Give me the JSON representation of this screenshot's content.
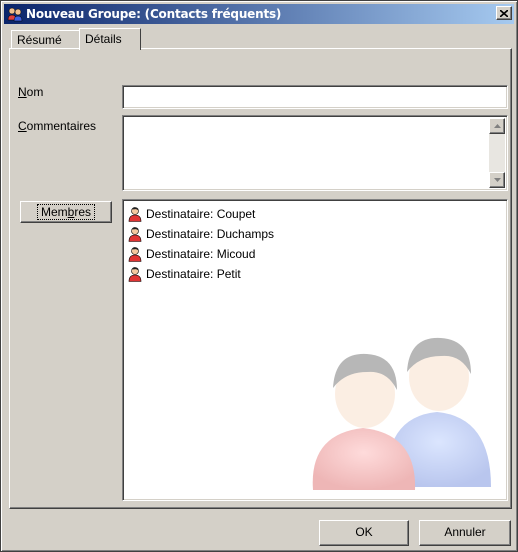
{
  "window": {
    "title": "Nouveau Groupe: (Contacts fréquents)",
    "close_glyph": "×"
  },
  "tabs": [
    {
      "label": "Résumé",
      "active": false
    },
    {
      "label": "Détails",
      "active": true
    }
  ],
  "form": {
    "nom_label_u": "N",
    "nom_label_rest": "om",
    "nom_value": "",
    "commentaires_label_u": "C",
    "commentaires_label_rest": "ommentaires",
    "commentaires_value": "",
    "membres_button_pre": "Mem",
    "membres_button_u": "b",
    "membres_button_post": "res"
  },
  "members": [
    {
      "label": "Destinataire: Coupet"
    },
    {
      "label": "Destinataire: Duchamps"
    },
    {
      "label": "Destinataire: Micoud"
    },
    {
      "label": "Destinataire: Petit"
    }
  ],
  "footer": {
    "ok_label": "OK",
    "cancel_label": "Annuler"
  },
  "colors": {
    "title_gradient_start": "#0a246a",
    "title_gradient_end": "#a6caf0",
    "face": "#d4d0c8"
  },
  "icons": {
    "title": "group-icon",
    "member": "contact-person-icon",
    "watermark": "group-watermark-icon"
  }
}
